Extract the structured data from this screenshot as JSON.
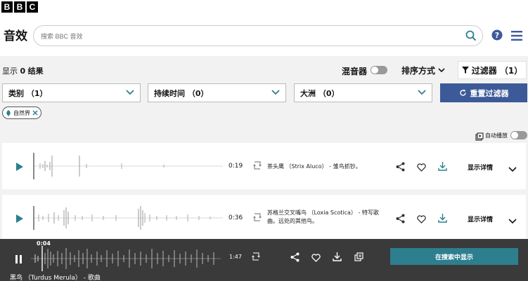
{
  "brand": {
    "letters": [
      "B",
      "B",
      "C"
    ]
  },
  "header": {
    "title": "音效",
    "search_placeholder": "搜索 BBC 音效"
  },
  "toolbar": {
    "results_prefix": "显示",
    "results_count": "0",
    "results_suffix": "结果",
    "mixer_label": "混音器",
    "sort_label": "排序方式",
    "filter_label": "过滤器 （1）"
  },
  "filters": {
    "category": "类别 （1）",
    "duration": "持续时间 （0）",
    "continent": "大洲 （0）",
    "reset_label": "重置过滤器",
    "active_chip": "自然界"
  },
  "autoplay_label": "自动播放",
  "sounds": [
    {
      "duration": "0:19",
      "description": "茶头鹰 （Strix Aluco） - 雏鸟抓钞。",
      "details_label": "显示详情"
    },
    {
      "duration": "0:36",
      "description": "苏格兰交叉嘴鸟 （Loxia Scotica） - 特写歌曲。远处的其他鸟。",
      "details_label": "显示详情"
    }
  ],
  "player": {
    "elapsed": "0:04",
    "duration": "1:47",
    "show_in_search_label": "在搜索中显示",
    "now_playing": "黑鸟 （Turdus Merula） - 歌曲"
  },
  "colors": {
    "accent_blue": "#3d5a98",
    "teal": "#2d7e8f",
    "player_bg": "#3a3a3a"
  }
}
